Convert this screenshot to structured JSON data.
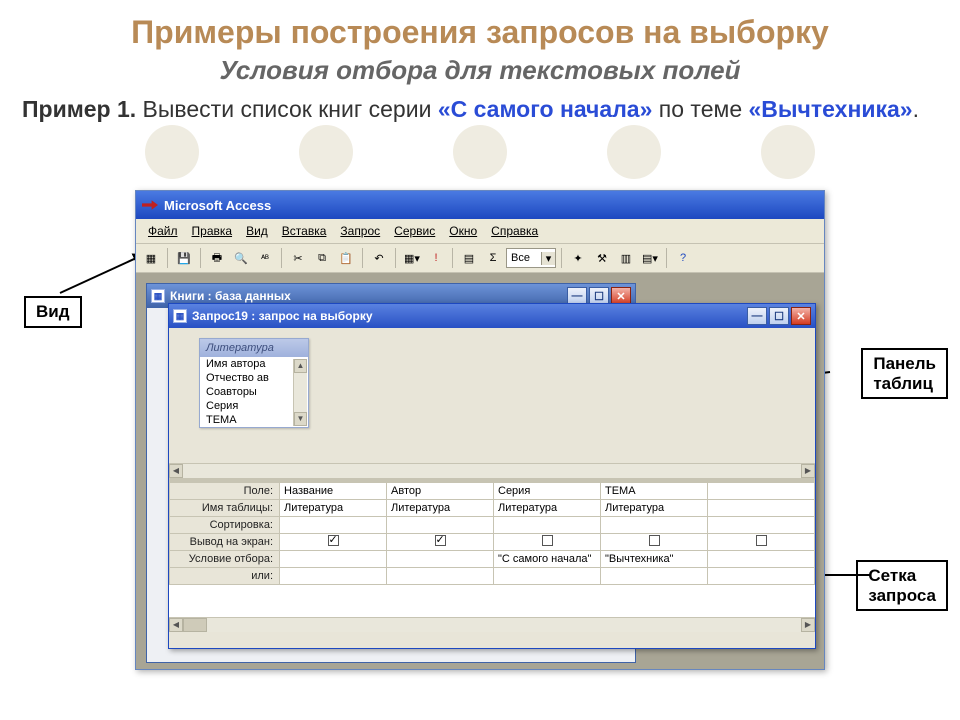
{
  "page_title": "Примеры построения запросов на выборку",
  "subtitle": "Условия отбора для текстовых полей",
  "example": {
    "label": "Пример 1.",
    "text_before": " Вывести список книг серии ",
    "quoted1": "«С самого начала»",
    "text_mid": " по теме ",
    "quoted2": "«Вычтехника»",
    "trailing": "."
  },
  "callouts": {
    "vid": "Вид",
    "panel": "Панель\nтаблиц",
    "grid": "Сетка\nзапроса"
  },
  "access": {
    "title": "Microsoft Access",
    "menu": [
      "Файл",
      "Правка",
      "Вид",
      "Вставка",
      "Запрос",
      "Сервис",
      "Окно",
      "Справка"
    ],
    "toolbar_combo": "Все",
    "mdi_back_title": "Книги : база данных",
    "mdi_front_title": "Запрос19 : запрос на выборку",
    "table_box": {
      "name": "Литература",
      "fields": [
        "Имя автора",
        "Отчество ав",
        "Соавторы",
        "Серия",
        "ТЕМА"
      ]
    },
    "grid": {
      "rows": [
        "Поле:",
        "Имя таблицы:",
        "Сортировка:",
        "Вывод на экран:",
        "Условие отбора:",
        "или:"
      ],
      "cols": [
        {
          "field": "Название",
          "table": "Литература",
          "show": true,
          "cond": ""
        },
        {
          "field": "Автор",
          "table": "Литература",
          "show": true,
          "cond": ""
        },
        {
          "field": "Серия",
          "table": "Литература",
          "show": false,
          "cond": "\"С самого начала\""
        },
        {
          "field": "ТЕМА",
          "table": "Литература",
          "show": false,
          "cond": "\"Вычтехника\""
        }
      ]
    }
  }
}
